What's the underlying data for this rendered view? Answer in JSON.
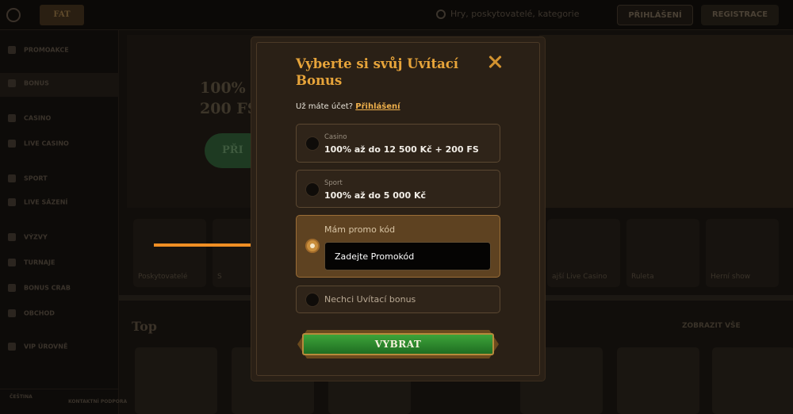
{
  "header": {
    "logo_text": "FAT",
    "search_placeholder": "Hry, poskytovatelé, kategorie",
    "login_label": "PŘIHLÁŠENÍ",
    "register_label": "REGISTRACE"
  },
  "sidebar": {
    "items": [
      {
        "label": "PROMOAKCE",
        "icon": "gift-icon"
      },
      {
        "label": "BONUS",
        "icon": "star-icon"
      },
      {
        "label": "CASINO",
        "icon": "cherry-icon"
      },
      {
        "label": "LIVE CASINO",
        "icon": "cards-icon"
      },
      {
        "label": "SPORT",
        "icon": "ball-icon"
      },
      {
        "label": "LIVE SÁZENÍ",
        "icon": "live-icon"
      },
      {
        "label": "VÝZVY",
        "icon": "trophy-icon"
      },
      {
        "label": "TURNAJE",
        "icon": "cup-icon"
      },
      {
        "label": "BONUS CRAB",
        "icon": "crab-icon"
      },
      {
        "label": "OBCHOD",
        "icon": "shop-icon"
      },
      {
        "label": "VIP ÚROVNĚ",
        "icon": "crown-icon"
      }
    ],
    "bottom_left": "ČEŠTINA",
    "bottom_right": "KONTAKTNÍ PODPORA"
  },
  "hero": {
    "line1": "100% a",
    "line2": "200 FS",
    "button_label": "PŘI"
  },
  "categories": [
    "Poskytovatelé",
    "S",
    "",
    "",
    "",
    "ajší Live Casino",
    "Ruleta",
    "Herní show"
  ],
  "top_section": {
    "title": "Top",
    "see_all": "ZOBRAZIT VŠE"
  },
  "modal": {
    "title": "Vyberte si svůj Uvítací Bonus",
    "account_question": "Už máte účet?",
    "account_link": "Přihlášení",
    "options": [
      {
        "category": "Casino",
        "value": "100% až do 12 500 Kč + 200 FS",
        "selected": false
      },
      {
        "category": "Sport",
        "value": "100% až do 5 000 Kč",
        "selected": false
      }
    ],
    "promo": {
      "label": "Mám promo kód",
      "placeholder": "Zadejte Promokód",
      "selected": true
    },
    "no_bonus_label": "Nechci Uvítací bonus",
    "submit_label": "VYBRAT"
  },
  "colors": {
    "accent": "#e7a43a",
    "arrow": "#f08f24",
    "submit_green": "#2f8a2f",
    "modal_bg": "#2a2016"
  }
}
